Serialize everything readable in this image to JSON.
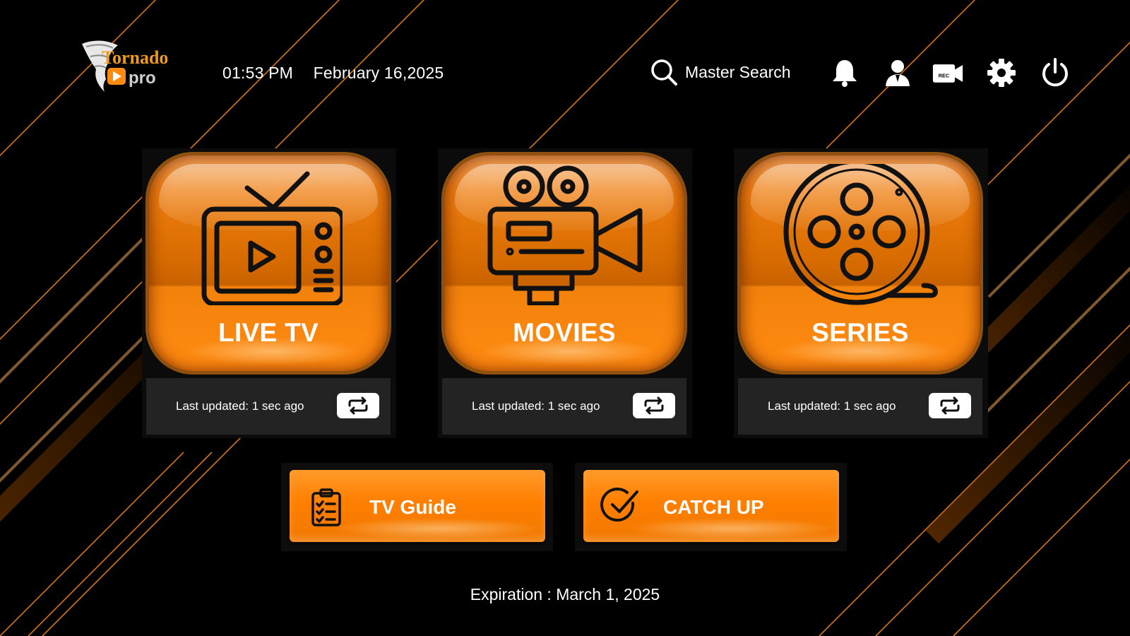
{
  "app": {
    "logo_text_top": "Tornado",
    "logo_text_bottom": "pro",
    "brand_color": "#ff7f00"
  },
  "header": {
    "time": "01:53 PM",
    "date": "February 16,2025",
    "search_label": "Master Search",
    "icons": [
      "search-icon",
      "bell-icon",
      "profile-icon",
      "rec-icon",
      "gear-icon",
      "power-icon"
    ],
    "rec_badge": "REC"
  },
  "tiles": [
    {
      "title": "LIVE TV",
      "updated": "Last updated: 1 sec ago",
      "icon": "tv-icon"
    },
    {
      "title": "MOVIES",
      "updated": "Last updated: 1 sec ago",
      "icon": "movie-camera-icon"
    },
    {
      "title": "SERIES",
      "updated": "Last updated: 1 sec ago",
      "icon": "film-reel-icon"
    }
  ],
  "buttons": {
    "tv_guide": "TV Guide",
    "catch_up": "CATCH UP"
  },
  "footer": {
    "expiration": "Expiration : March 1, 2025"
  }
}
